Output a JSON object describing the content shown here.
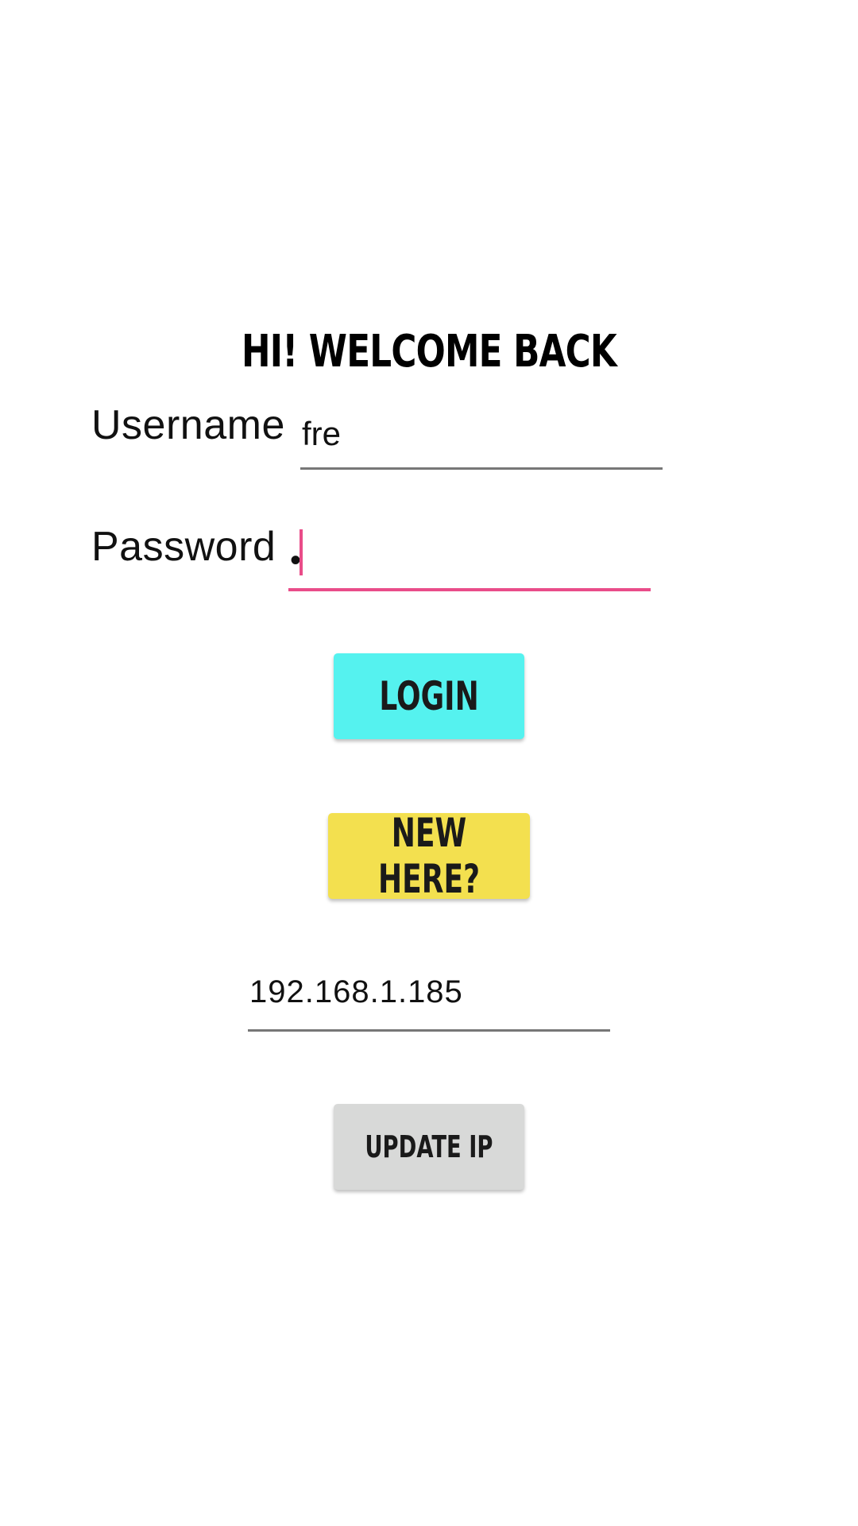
{
  "app": {
    "title": "HI! WELCOME BACK"
  },
  "login_form": {
    "username_label": "Username",
    "username_value": "fre",
    "password_label": "Password",
    "password_value": "•"
  },
  "buttons": {
    "login_label": "LOGIN",
    "new_here_label": "NEW HERE?",
    "update_ip_label": "UPDATE IP"
  },
  "server": {
    "ip_value": "192.168.1.185"
  },
  "colors": {
    "login_button": "#55f2ef",
    "new_here_button": "#f3e04f",
    "update_ip_button": "#d8d9d8",
    "focus_accent": "#e94c89",
    "input_underline": "#777777"
  }
}
